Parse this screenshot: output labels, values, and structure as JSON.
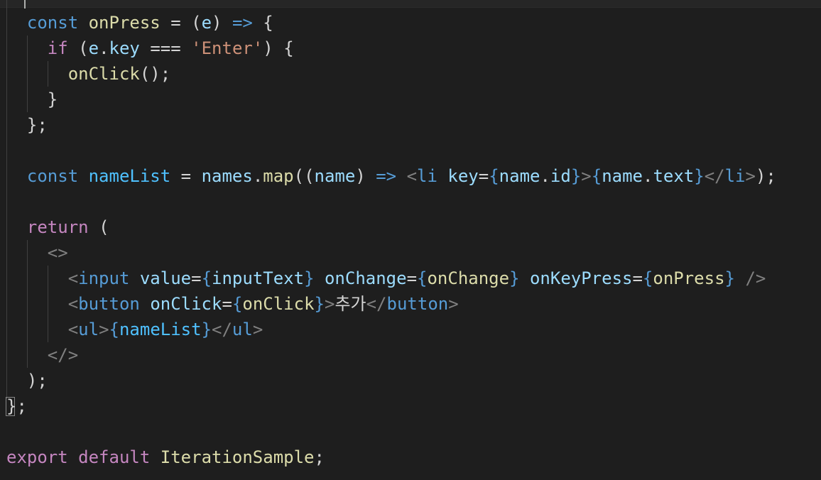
{
  "code": {
    "line1": [
      "const",
      "onPress",
      "=",
      "(",
      "e",
      ")",
      "=>",
      "{"
    ],
    "line2": [
      "if",
      "(",
      "e",
      ".",
      "key",
      "===",
      "'Enter'",
      ")",
      "{"
    ],
    "line3": [
      "onClick",
      "();"
    ],
    "line4": [
      "}"
    ],
    "line5": [
      "};"
    ],
    "line7": [
      "const",
      "nameList",
      "=",
      "names",
      ".",
      "map",
      "((",
      "name",
      ")",
      "=>",
      "<",
      "li",
      "key",
      "=",
      "{",
      "name",
      ".",
      "id",
      "}",
      ">",
      "{",
      "name",
      ".",
      "text",
      "}",
      "</",
      "li",
      ">",
      ");"
    ],
    "line9": [
      "return",
      "("
    ],
    "line10": [
      "<>"
    ],
    "line11": [
      "<",
      "input",
      "value",
      "=",
      "{",
      "inputText",
      "}",
      "onChange",
      "=",
      "{",
      "onChange",
      "}",
      "onKeyPress",
      "=",
      "{",
      "onPress",
      "}",
      "/>"
    ],
    "line12": [
      "<",
      "button",
      "onClick",
      "=",
      "{",
      "onClick",
      "}",
      ">",
      "추가",
      "</",
      "button",
      ">"
    ],
    "line13": [
      "<",
      "ul",
      ">",
      "{",
      "nameList",
      "}",
      "</",
      "ul",
      ">"
    ],
    "line14": [
      "</>"
    ],
    "line15": [
      ");"
    ],
    "line16": [
      "}",
      ";"
    ],
    "line18": [
      "export",
      "default",
      "IterationSample",
      ";"
    ]
  },
  "theme": {
    "background": "#1e1e1e",
    "keyword_blue": "#569cd6",
    "keyword_purple": "#c586c0",
    "function_yellow": "#dcdcaa",
    "variable_light_blue": "#9cdcfe",
    "constant_blue": "#4fc1ff",
    "string_orange": "#ce9178",
    "tag_gray": "#808080",
    "type_teal": "#4ec9b0",
    "brace_blue": "#179fff",
    "text": "#d4d4d4"
  }
}
